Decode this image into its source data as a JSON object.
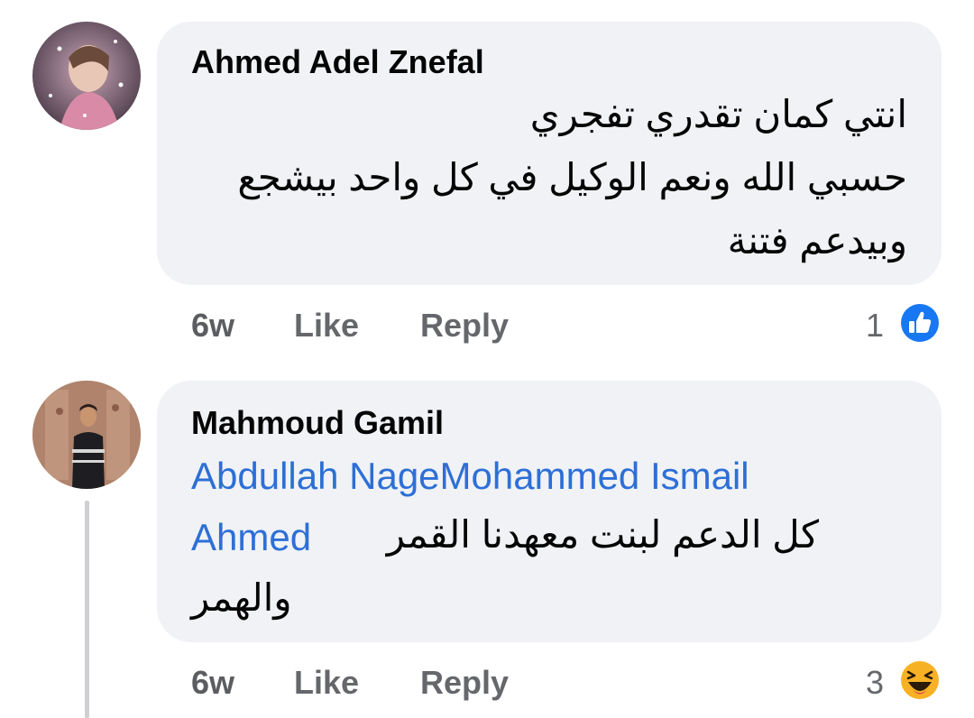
{
  "comments": [
    {
      "author": "Ahmed Adel Znefal",
      "lines": [
        "انتي كمان تقدري تفجري",
        "حسبي الله ونعم الوكيل في كل واحد بيشجع",
        "وبيدعم فتنة"
      ],
      "time": "6w",
      "like_label": "Like",
      "reply_label": "Reply",
      "reaction_count": "1",
      "reaction_icon": "like-icon"
    },
    {
      "author": "Mahmoud Gamil",
      "mention_line1": "Abdullah NageMohammed Ismail",
      "mention_line2": "Ahmed",
      "text_line2": "كل الدعم  لبنت معهدنا  القمر",
      "text_line3": "والهمر",
      "time": "6w",
      "like_label": "Like",
      "reply_label": "Reply",
      "reaction_count": "3",
      "reaction_icon": "haha-icon"
    }
  ],
  "colors": {
    "bubble": "#f0f2f5",
    "mention": "#2d6fd6",
    "meta": "#65676b",
    "like_blue": "#1877f2",
    "haha_yellow": "#f7b125"
  }
}
